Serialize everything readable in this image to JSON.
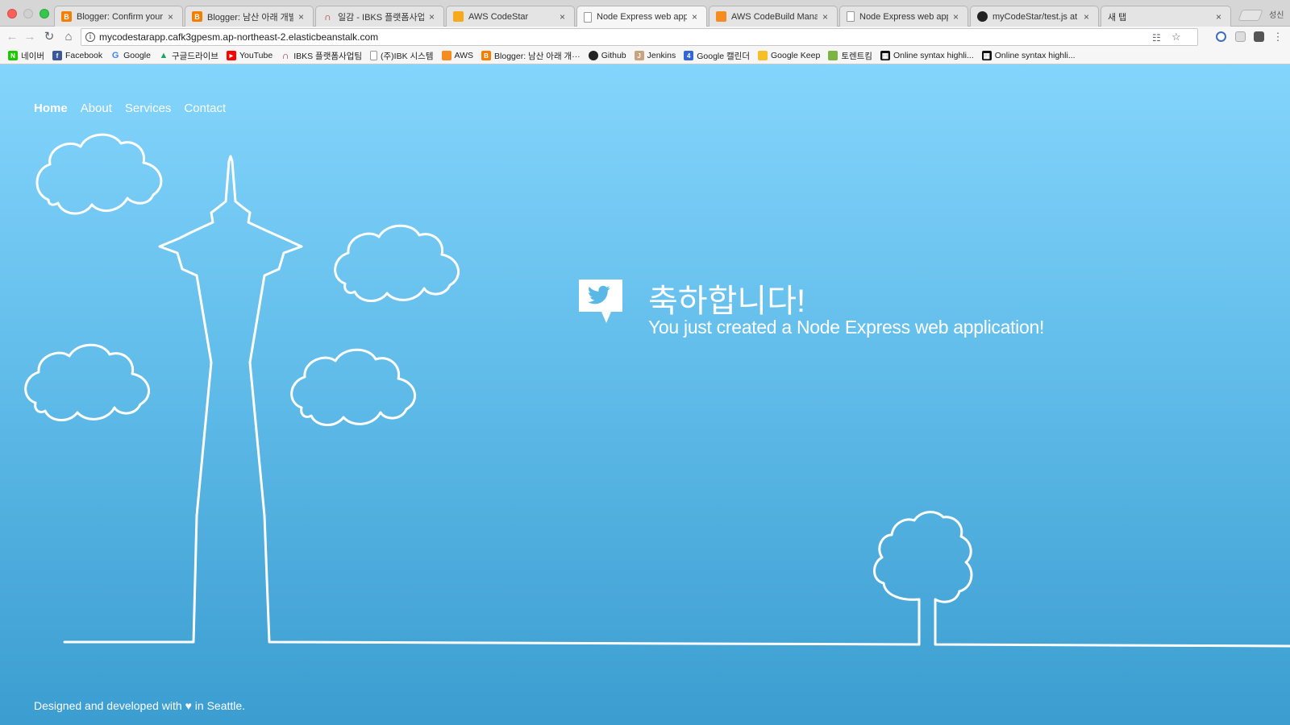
{
  "browser": {
    "tabs": [
      {
        "title": "Blogger: Confirm your pr",
        "favicon": "blogger-icon",
        "color": "#f57d00"
      },
      {
        "title": "Blogger: 남산 아래 개발자들",
        "favicon": "blogger-icon",
        "color": "#f57d00"
      },
      {
        "title": "일감 - IBKS 플랫폼사업팀",
        "favicon": "redmine-icon",
        "color": "#b32024"
      },
      {
        "title": "AWS CodeStar",
        "favicon": "aws-icon",
        "color": "#f7a81b"
      },
      {
        "title": "Node Express web applic",
        "favicon": "page-icon",
        "color": "#888888"
      },
      {
        "title": "AWS CodeBuild Manage",
        "favicon": "aws-icon",
        "color": "#f68b1f"
      },
      {
        "title": "Node Express web applic",
        "favicon": "page-icon",
        "color": "#888888"
      },
      {
        "title": "myCodeStar/test.js at m",
        "favicon": "github-icon",
        "color": "#222222"
      },
      {
        "title": "새 탭",
        "favicon": "",
        "color": ""
      }
    ],
    "active_tab_index": 4,
    "profile_name": "성신",
    "url": "mycodestarapp.cafk3gpesm.ap-northeast-2.elasticbeanstalk.com",
    "close_glyph": "×"
  },
  "bookmarks": [
    {
      "label": "네이버",
      "icon": "naver-icon",
      "color": "#1ec800",
      "glyph": "N"
    },
    {
      "label": "Facebook",
      "icon": "facebook-icon",
      "color": "#3b5998",
      "glyph": "f"
    },
    {
      "label": "Google",
      "icon": "google-icon",
      "color": "#4285f4",
      "glyph": "G"
    },
    {
      "label": "구글드라이브",
      "icon": "drive-icon",
      "color": "#1fa463",
      "glyph": "▲"
    },
    {
      "label": "YouTube",
      "icon": "youtube-icon",
      "color": "#ff0000",
      "glyph": "▶"
    },
    {
      "label": "IBKS 플랫폼사업팀",
      "icon": "redmine-icon",
      "color": "#b32024",
      "glyph": "∩"
    },
    {
      "label": "(주)IBK 시스템",
      "icon": "page-icon",
      "color": "#999999",
      "glyph": ""
    },
    {
      "label": "AWS",
      "icon": "aws-icon",
      "color": "#f68b1f",
      "glyph": ""
    },
    {
      "label": "Blogger: 남산 아래 개···",
      "icon": "blogger-icon",
      "color": "#f57d00",
      "glyph": "B"
    },
    {
      "label": "Github",
      "icon": "github-icon",
      "color": "#222222",
      "glyph": "●"
    },
    {
      "label": "Jenkins",
      "icon": "jenkins-icon",
      "color": "#c9a27e",
      "glyph": "J"
    },
    {
      "label": "Google 캘린더",
      "icon": "calendar-icon",
      "color": "#3367d6",
      "glyph": "4"
    },
    {
      "label": "Google Keep",
      "icon": "keep-icon",
      "color": "#f6bf26",
      "glyph": "K"
    },
    {
      "label": "토렌트킴",
      "icon": "torrent-icon",
      "color": "#7cb342",
      "glyph": "T"
    },
    {
      "label": "Online syntax highli...",
      "icon": "syntax-icon",
      "color": "#111111",
      "glyph": "▦"
    },
    {
      "label": "Online syntax highli...",
      "icon": "syntax-icon",
      "color": "#111111",
      "glyph": "▦"
    }
  ],
  "site": {
    "nav": [
      {
        "label": "Home",
        "current": true
      },
      {
        "label": "About",
        "current": false
      },
      {
        "label": "Services",
        "current": false
      },
      {
        "label": "Contact",
        "current": false
      }
    ],
    "hero_title": "축하합니다!",
    "hero_subtitle": "You just created a Node Express web application!",
    "footer": "Designed and developed with ♥ in Seattle."
  },
  "colors": {
    "gradient_top": "#84d5fc",
    "gradient_bottom": "#3b9dd0",
    "line_art": "#ffffff"
  }
}
